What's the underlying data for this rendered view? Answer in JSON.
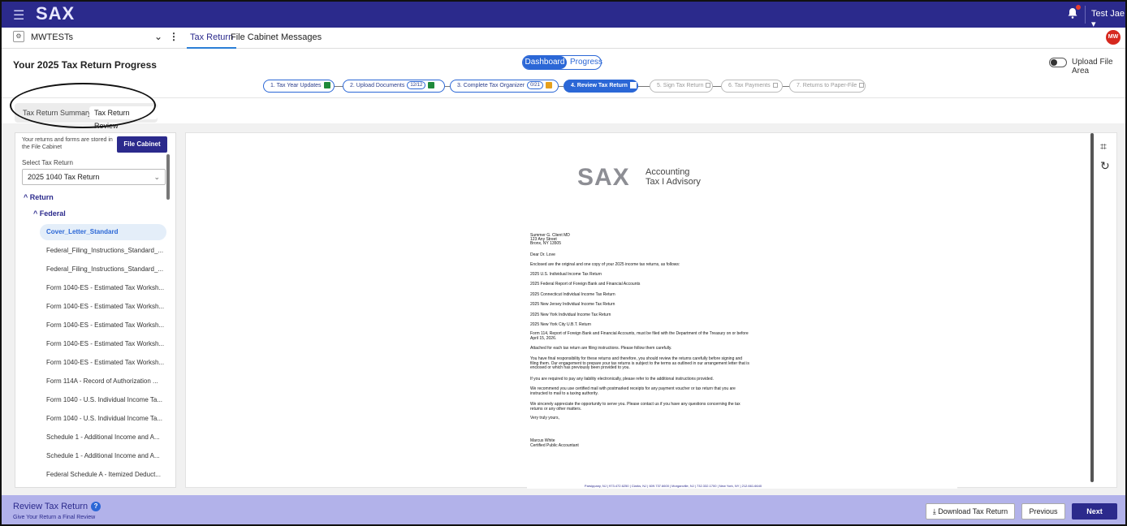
{
  "app": {
    "logo": "SAX",
    "menu_icon": "hamburger-icon"
  },
  "topbar": {
    "user_name": "Test Jae ▾",
    "notification_icon": "bell-icon"
  },
  "subbar": {
    "client_name": "MWTESTs",
    "tabs": [
      "Tax Return",
      "File Cabinet",
      "Messages"
    ],
    "active_tab": "Tax Return",
    "avatar_initials": "MW"
  },
  "header": {
    "title": "Your 2025 Tax Return Progress",
    "view_toggle": {
      "dashboard": "Dashboard",
      "progress": "Progress",
      "selected": "Dashboard"
    },
    "upload_toggle_label": "Upload File Area",
    "steps": [
      {
        "label": "1. Tax Year Updates",
        "status": "done"
      },
      {
        "label": "2. Upload Documents",
        "count": "12/12",
        "status": "done"
      },
      {
        "label": "3. Complete Tax Organizer",
        "count": "0/21",
        "status": "warning"
      },
      {
        "label": "4. Review Tax Return",
        "status": "current"
      },
      {
        "label": "5. Sign Tax Return",
        "status": "future"
      },
      {
        "label": "6. Tax Payments",
        "status": "future"
      },
      {
        "label": "7. Returns to Paper-File",
        "status": "future"
      }
    ]
  },
  "review_tabs": {
    "summary": "Tax Return Summary",
    "review": "Tax Return Review",
    "selected": "Tax Return Review"
  },
  "left_panel": {
    "store_note": "Your returns and forms are stored in the File Cabinet",
    "file_cabinet_button": "File Cabinet",
    "select_label": "Select Tax Return",
    "selected_return": "2025 1040 Tax Return",
    "tree_root": "Return",
    "tree_federal": "Federal",
    "files": [
      "Cover_Letter_Standard",
      "Federal_Filing_Instructions_Standard_...",
      "Federal_Filing_Instructions_Standard_...",
      "Form 1040-ES - Estimated Tax Worksh...",
      "Form 1040-ES - Estimated Tax Worksh...",
      "Form 1040-ES - Estimated Tax Worksh...",
      "Form 1040-ES - Estimated Tax Worksh...",
      "Form 1040-ES - Estimated Tax Worksh...",
      "Form 114A - Record of Authorization ...",
      "Form 1040 - U.S. Individual Income Ta...",
      "Form 1040 - U.S. Individual Income Ta...",
      "Schedule 1 - Additional Income and A...",
      "Schedule 1 - Additional Income and A...",
      "Federal Schedule A - Itemized Deduct..."
    ],
    "selected_file": "Cover_Letter_Standard"
  },
  "document": {
    "logo": "SAX",
    "tagline_1": "Accounting",
    "tagline_2": "Tax I Advisory",
    "address_1": "Summer G. Client MD",
    "address_2": "123 Any Street",
    "address_3": "Bronx, NY 13505",
    "salutation": "Dear Dr. Love",
    "intro": "Enclosed are the original and one copy of your 2025 income tax returns, as follows:",
    "returns": [
      "2025 U.S. Individual Income Tax Return",
      "2025 Federal Report of Foreign Bank and Financial Accounts",
      "2025 Connecticut Individual Income Tax Return",
      "2025 New Jersey Individual Income Tax Return",
      "2025 New York Individual Income Tax Return",
      "2025 New York City U.B.T. Return"
    ],
    "fbar_note": "Form 114, Report of Foreign Bank and Financial Accounts, must be filed with the Department of the Treasury on or before April 15, 2026.",
    "attached": "Attached for each tax return are filing instructions. Please follow them carefully.",
    "responsibility": "You have final responsibility for these returns and therefore, you should review the returns carefully before signing and filing them. Our engagement to prepare your tax returns is subject to the terms as outlined in our arrangement letter that is enclosed or which has previously been provided to you.",
    "electronic": "If you are required to pay any liability electronically, please refer to the additional instructions provided.",
    "certified": "We recommend you use certified mail with postmarked receipts for any payment voucher or tax return that you are instructed to mail to a taxing authority.",
    "appreciate": "We sincerely appreciate the opportunity to serve you.  Please contact us if you have any questions concerning the tax returns or any other matters.",
    "closing": "Very truly yours,",
    "signer": "Marcus White",
    "signer_title": "Certified Public Accountant",
    "footer": "Parsippany, NJ | 973.472.6250 | Clarks, NJ | 609.737.6600 | Morganville, NJ | 732.332.1700 | New York, NY | 212.661.6640"
  },
  "bottom": {
    "title": "Review Tax Return",
    "subtitle": "Give Your Return a Final Review",
    "download_button": "Download Tax Return",
    "previous_button": "Previous",
    "next_button": "Next"
  }
}
